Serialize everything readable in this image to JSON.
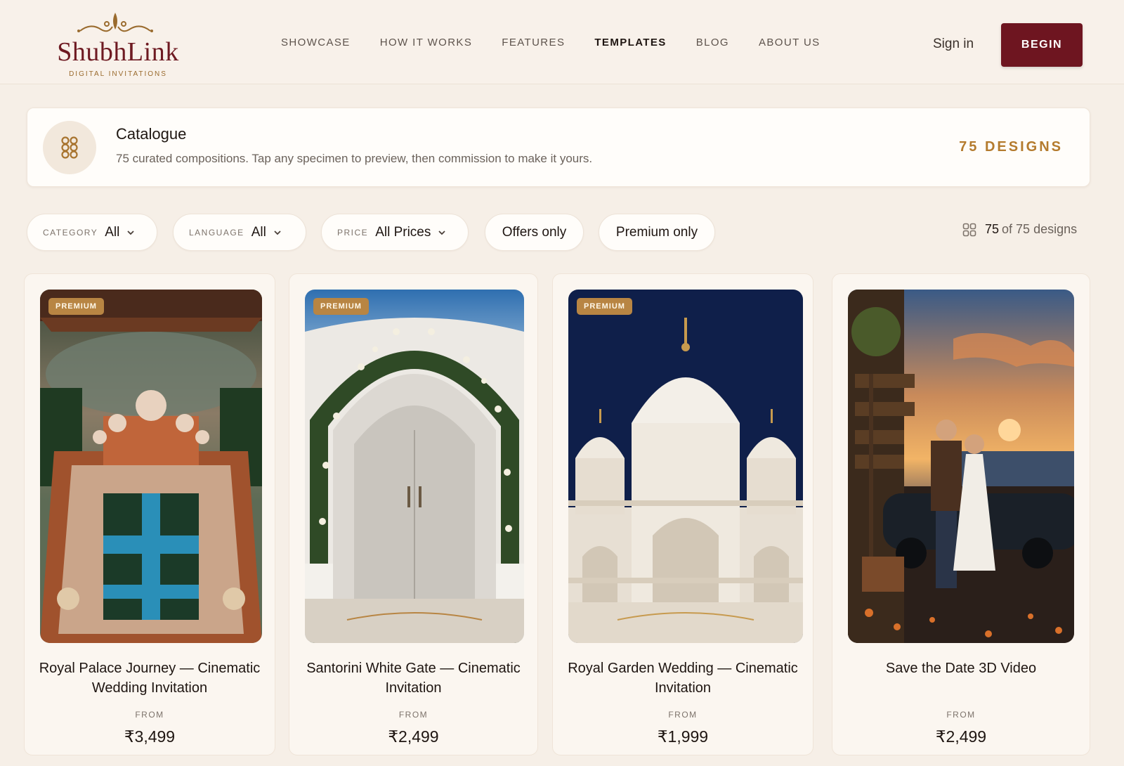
{
  "brand": {
    "name": "ShubhLink",
    "tagline": "DIGITAL INVITATIONS",
    "accent": "#6e1520",
    "gold": "#b47b2e"
  },
  "nav": {
    "items": [
      "SHOWCASE",
      "HOW IT WORKS",
      "FEATURES",
      "TEMPLATES",
      "BLOG",
      "ABOUT US"
    ],
    "active": "TEMPLATES",
    "signin": "Sign in",
    "begin": "BEGIN"
  },
  "catalogue": {
    "icon": "grid-icon",
    "title": "Catalogue",
    "description": "75 curated compositions. Tap any specimen to preview, then commission to make it yours.",
    "count_label": "75 DESIGNS"
  },
  "filters": {
    "category": {
      "key": "CATEGORY",
      "value": "All"
    },
    "language": {
      "key": "LANGUAGE",
      "value": "All"
    },
    "price": {
      "key": "PRICE",
      "value": "All Prices"
    },
    "offers": "Offers only",
    "premium": "Premium only"
  },
  "results": {
    "shown": "75",
    "suffix": "of 75 designs"
  },
  "cards": [
    {
      "badge": "PREMIUM",
      "title": "Royal Palace Journey — Cinematic Wedding Invitation",
      "from": "FROM",
      "price": "₹3,499"
    },
    {
      "badge": "PREMIUM",
      "title": "Santorini White Gate — Cinematic Invitation",
      "from": "FROM",
      "price": "₹2,499"
    },
    {
      "badge": "PREMIUM",
      "title": "Royal Garden Wedding — Cinematic Invitation",
      "from": "FROM",
      "price": "₹1,999"
    },
    {
      "badge": "",
      "title": "Save the Date 3D Video",
      "from": "FROM",
      "price": "₹2,499"
    }
  ]
}
